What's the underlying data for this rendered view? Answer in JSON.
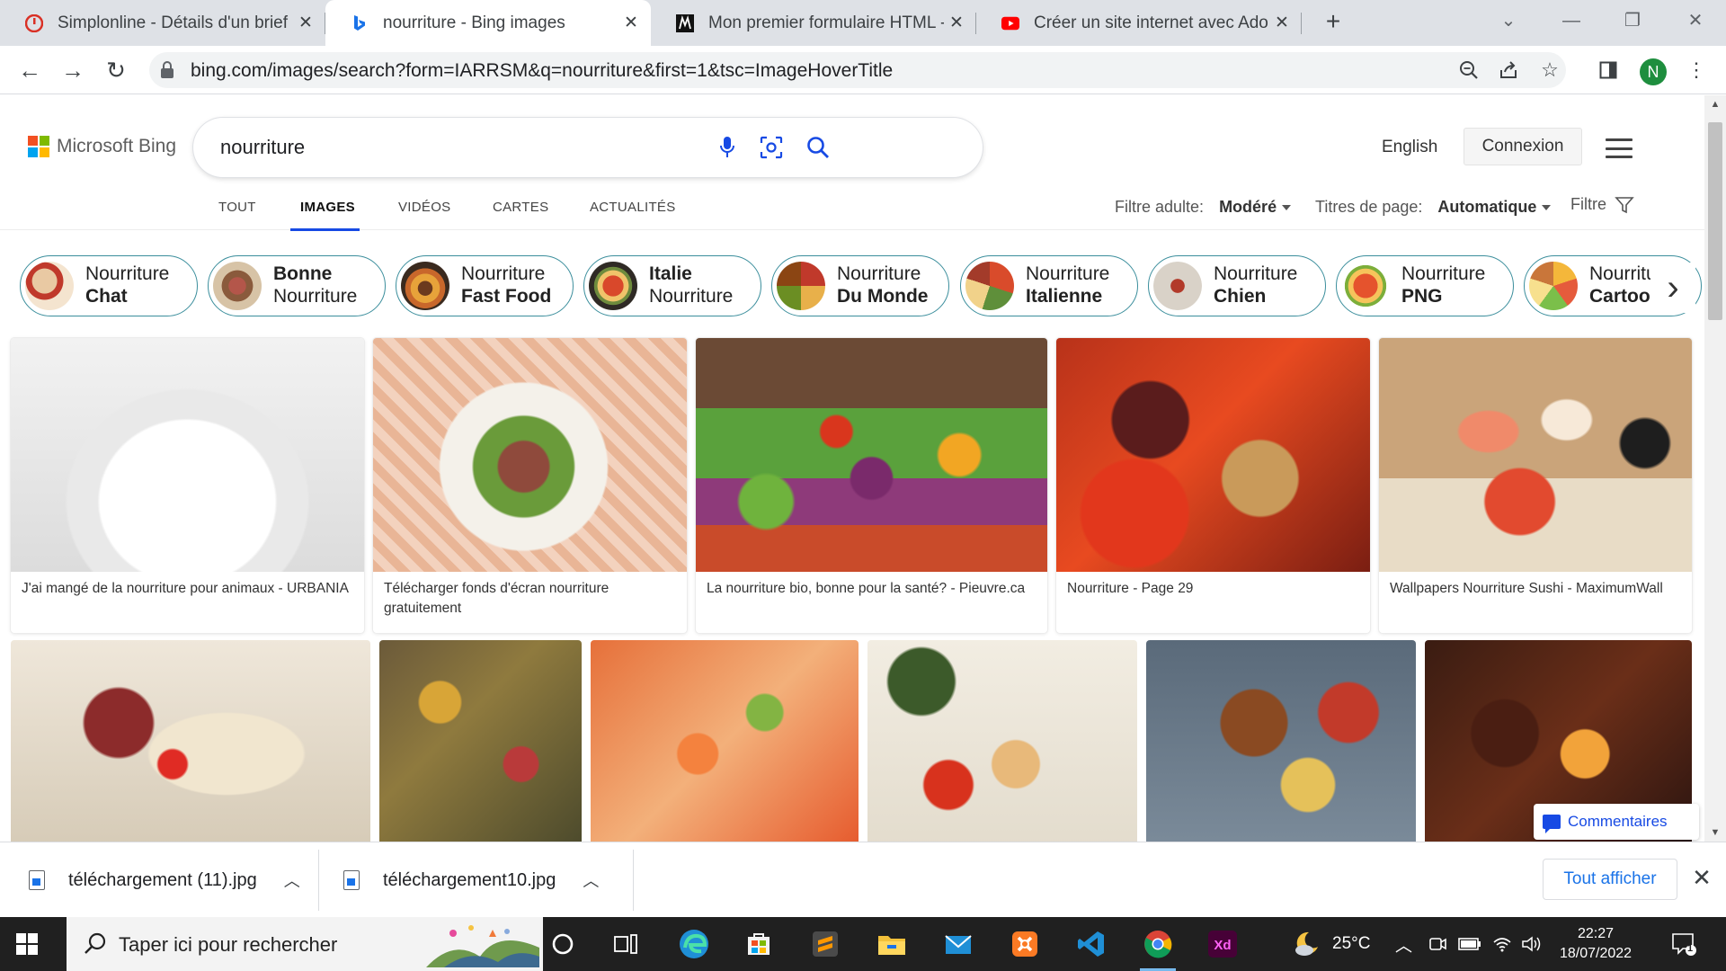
{
  "browser": {
    "tabs": [
      {
        "title": "Simplonline - Détails d'un brief",
        "icon": "simplon-icon",
        "active": false
      },
      {
        "title": "nourriture - Bing images",
        "icon": "bing-icon",
        "active": true
      },
      {
        "title": "Mon premier formulaire HTML - ",
        "icon": "m-icon",
        "active": false
      },
      {
        "title": "Créer un site internet avec Adobe",
        "icon": "youtube-icon",
        "active": false
      }
    ],
    "tab_close": "✕",
    "new_tab": "+",
    "url": "bing.com/images/search?form=IARRSM&q=nourriture&first=1&tsc=ImageHoverTitle",
    "profile_initial": "N"
  },
  "bing": {
    "brand": "Microsoft Bing",
    "query": "nourriture",
    "language": "English",
    "login": "Connexion",
    "scopes": [
      "TOUT",
      "IMAGES",
      "VIDÉOS",
      "CARTES",
      "ACTUALITÉS"
    ],
    "active_scope": "IMAGES",
    "filters": {
      "adult_label": "Filtre adulte:",
      "adult_value": "Modéré",
      "titles_label": "Titres de page:",
      "titles_value": "Automatique",
      "filter_label": "Filtre"
    },
    "related": [
      {
        "l1": "Nourriture",
        "l2": "Chat",
        "bold": "l2"
      },
      {
        "l1": "Bonne",
        "l2": "Nourriture",
        "bold": "l1"
      },
      {
        "l1": "Nourriture",
        "l2": "Fast Food",
        "bold": "l2"
      },
      {
        "l1": "Italie",
        "l2": "Nourriture",
        "bold": "l1"
      },
      {
        "l1": "Nourriture",
        "l2": "Du Monde",
        "bold": "l2"
      },
      {
        "l1": "Nourriture",
        "l2": "Italienne",
        "bold": "l2"
      },
      {
        "l1": "Nourriture",
        "l2": "Chien",
        "bold": "l2"
      },
      {
        "l1": "Nourriture",
        "l2": "PNG",
        "bold": "l2"
      },
      {
        "l1": "Nourriture",
        "l2": "Cartoon",
        "bold": "l2"
      }
    ],
    "results_row1": [
      {
        "caption": "J'ai mangé de la nourriture pour animaux - URBANIA"
      },
      {
        "caption": "Télécharger fonds d'écran nourriture gratuitement"
      },
      {
        "caption": "La nourriture bio, bonne pour la santé? - Pieuvre.ca"
      },
      {
        "caption": "Nourriture - Page 29"
      },
      {
        "caption": "Wallpapers Nourriture Sushi - MaximumWall"
      }
    ],
    "feedback": "Commentaires"
  },
  "downloads": {
    "items": [
      {
        "name": "téléchargement (11).jpg"
      },
      {
        "name": "téléchargement10.jpg"
      }
    ],
    "show_all": "Tout afficher"
  },
  "taskbar": {
    "search_placeholder": "Taper ici pour rechercher",
    "weather": "25°C",
    "time": "22:27",
    "date": "18/07/2022",
    "notifications": "1"
  },
  "colors": {
    "pill_border": "#3b8e9c",
    "bing_blue": "#174ae4",
    "chrome_tabstrip": "#dee1e6"
  }
}
